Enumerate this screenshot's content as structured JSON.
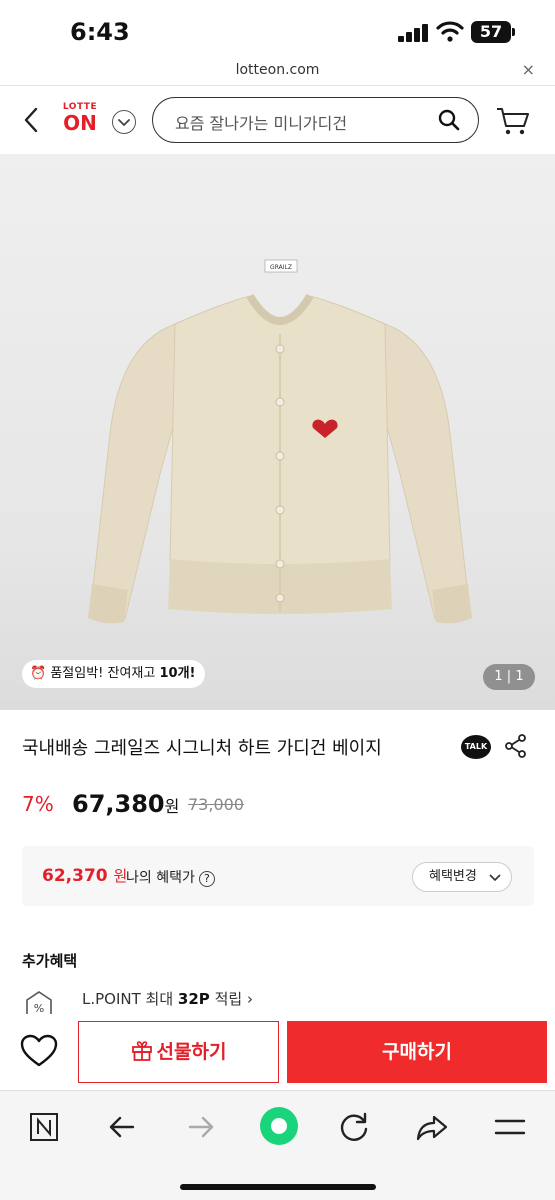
{
  "status": {
    "time": "6:43",
    "battery": "57"
  },
  "browser": {
    "url": "lotteon.com",
    "close": "×"
  },
  "header": {
    "logo_top": "LOTTE",
    "logo_main": "ON",
    "search_placeholder": "요즘 잘나가는 미니가디건"
  },
  "product": {
    "stock_text": "품절임박! 잔여재고 ",
    "stock_count": "10개!",
    "pager": "1 | 1",
    "title": "국내배송 그레일즈 시그니처 하트 가디건 베이지",
    "talk": "TALK",
    "discount": "7%",
    "price": "67,380",
    "won": "원",
    "original_price": "73,000",
    "brand_tag": "GRAILZ"
  },
  "benefit": {
    "price": "62,370",
    "won": "원",
    "label": "나의 혜택가",
    "change_button": "혜택변경"
  },
  "extra": {
    "heading": "추가혜택",
    "point_prefix": "L.POINT 최대 ",
    "point_value": "32P",
    "point_suffix": " 적립"
  },
  "buybar": {
    "gift_button": "선물하기",
    "buy_button": "구매하기"
  },
  "colors": {
    "accent": "#e3202a",
    "buy": "#ef2b2b",
    "cardigan": "#e8dfc9"
  }
}
